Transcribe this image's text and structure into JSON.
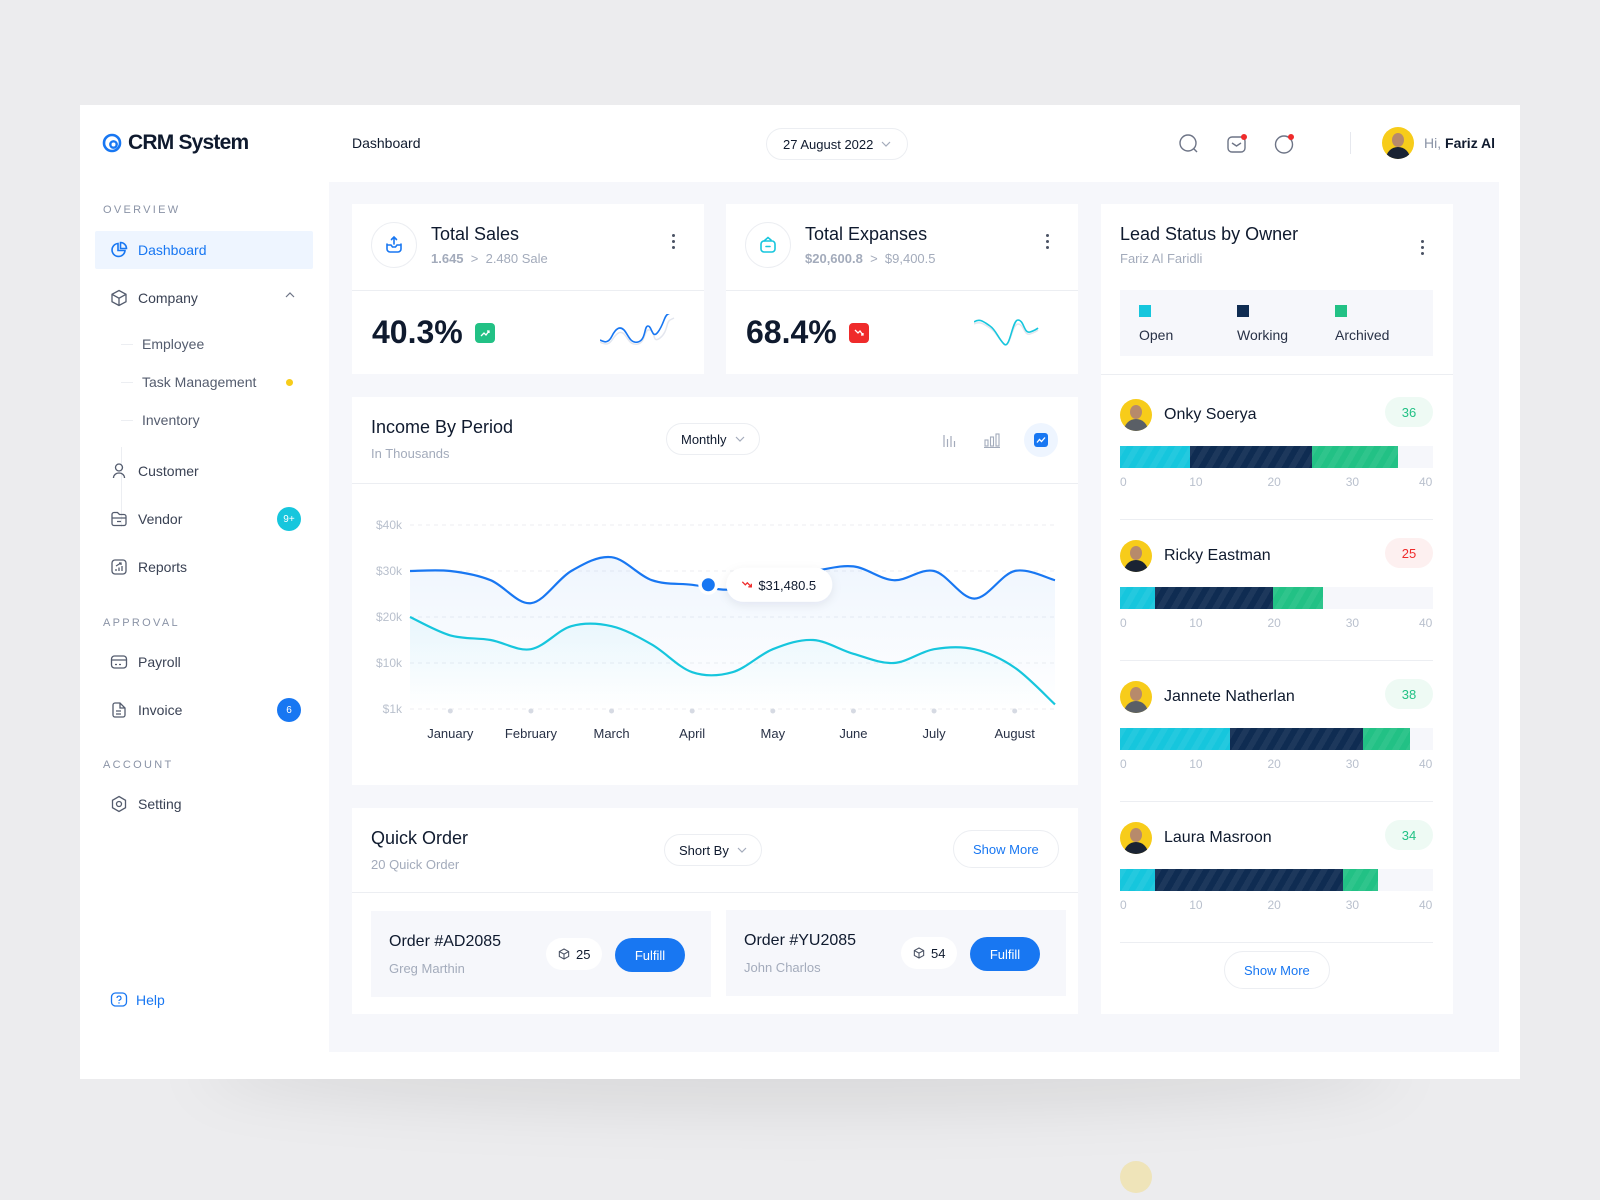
{
  "app": {
    "name": "CRM System",
    "page_title": "Dashboard",
    "date": "27 August 2022",
    "user": {
      "greeting": "Hi,",
      "name": "Fariz Al"
    },
    "icons": [
      "search-icon",
      "mail-icon",
      "notification-icon"
    ],
    "colors": {
      "primary": "#1877f2",
      "cyan": "#16c6dd",
      "navy": "#0f2c52",
      "green": "#22c185",
      "red": "#ef2b2b",
      "yellow": "#f7cc1a"
    }
  },
  "sidebar": {
    "sections": {
      "overview": "OVERVIEW",
      "approval": "APPROVAL",
      "account": "ACCOUNT"
    },
    "items": {
      "dashboard": "Dashboard",
      "company": "Company",
      "employee": "Employee",
      "task_management": "Task Management",
      "inventory": "Inventory",
      "customer": "Customer",
      "vendor": "Vendor",
      "vendor_badge": "9+",
      "reports": "Reports",
      "payroll": "Payroll",
      "invoice": "Invoice",
      "invoice_badge": "6",
      "setting": "Setting",
      "help": "Help"
    }
  },
  "stats": [
    {
      "title": "Total Sales",
      "from": "1.645",
      "to": "2.480 Sale",
      "value": "40.3%",
      "trend": "up"
    },
    {
      "title": "Total Expanses",
      "from": "$20,600.8",
      "to": "$9,400.5",
      "value": "68.4%",
      "trend": "down"
    }
  ],
  "income": {
    "title": "Income By Period",
    "subtitle": "In Thousands",
    "period": "Monthly",
    "chart_types": [
      "bar-chart-icon",
      "column-chart-icon",
      "line-chart-icon"
    ],
    "tooltip": "$31,480.5"
  },
  "chart_data": {
    "type": "line",
    "title": "Income By Period",
    "subtitle": "In Thousands",
    "categories": [
      "January",
      "February",
      "March",
      "April",
      "May",
      "June",
      "July",
      "August"
    ],
    "y_tick_labels": [
      "$40k",
      "$30k",
      "$20k",
      "$10k",
      "$1k"
    ],
    "ylim": [
      0,
      40
    ],
    "grid": true,
    "series": [
      {
        "name": "Income",
        "color": "#1877f2",
        "x": [
          -0.5,
          0,
          0.5,
          1,
          1.5,
          2,
          2.5,
          3,
          3.5,
          4,
          4.5,
          5,
          5.5,
          6,
          6.5,
          7,
          7.5
        ],
        "values": [
          30,
          30,
          28,
          23,
          30,
          33,
          28,
          27,
          26,
          29,
          30,
          31,
          28,
          30,
          24,
          30,
          28
        ]
      },
      {
        "name": "Expenses",
        "color": "#16c6dd",
        "x": [
          -0.5,
          0,
          0.5,
          1,
          1.5,
          2,
          2.5,
          3,
          3.5,
          4,
          4.5,
          5,
          5.5,
          6,
          6.5,
          7,
          7.5
        ],
        "values": [
          20,
          16,
          15,
          13,
          18,
          18,
          14,
          8,
          8,
          13,
          15,
          12,
          10,
          13,
          13,
          9,
          1
        ]
      }
    ],
    "highlight": {
      "series": "Income",
      "x": 3.2,
      "label": "$31,480.5",
      "trend": "down"
    }
  },
  "quick_order": {
    "title": "Quick Order",
    "subtitle": "20 Quick Order",
    "sort_label": "Short By",
    "show_more": "Show More",
    "orders": [
      {
        "id": "Order #AD2085",
        "customer": "Greg Marthin",
        "qty": "25",
        "action": "Fulfill"
      },
      {
        "id": "Order #YU2085",
        "customer": "John Charlos",
        "qty": "54",
        "action": "Fulfill"
      }
    ]
  },
  "leads": {
    "title": "Lead Status by Owner",
    "subtitle": "Fariz Al Faridli",
    "legend": [
      "Open",
      "Working",
      "Archived"
    ],
    "axis": [
      "0",
      "10",
      "20",
      "30",
      "40"
    ],
    "axis_max": 40,
    "show_more": "Show More",
    "owners": [
      {
        "name": "Onky Soerya",
        "count": "36",
        "status": "good",
        "open": 9,
        "working": 15.5,
        "archived": 11
      },
      {
        "name": "Ricky Eastman",
        "count": "25",
        "status": "bad",
        "open": 4.5,
        "working": 15,
        "archived": 6.5
      },
      {
        "name": "Jannete Natherlan",
        "count": "38",
        "status": "good",
        "open": 14,
        "working": 17,
        "archived": 6
      },
      {
        "name": "Laura Masroon",
        "count": "34",
        "status": "good",
        "open": 4.5,
        "working": 24,
        "archived": 4.5
      }
    ]
  }
}
